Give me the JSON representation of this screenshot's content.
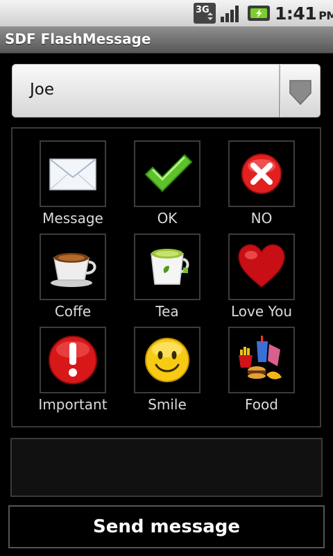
{
  "status_bar": {
    "network": "3G",
    "time": "1:41",
    "ampm": "PM"
  },
  "title_bar": {
    "title": "SDF FlashMessage"
  },
  "recipient": {
    "selected": "Joe"
  },
  "messages": [
    {
      "label": "Message",
      "icon": "envelope-icon"
    },
    {
      "label": "OK",
      "icon": "checkmark-icon"
    },
    {
      "label": "NO",
      "icon": "red-x-icon"
    },
    {
      "label": "Coffe",
      "icon": "coffee-cup-icon"
    },
    {
      "label": "Tea",
      "icon": "tea-cup-icon"
    },
    {
      "label": "Love You",
      "icon": "heart-icon"
    },
    {
      "label": "Important",
      "icon": "exclamation-icon"
    },
    {
      "label": "Smile",
      "icon": "smiley-icon"
    },
    {
      "label": "Food",
      "icon": "food-icon"
    }
  ],
  "message_text": "",
  "actions": {
    "send_label": "Send message"
  }
}
